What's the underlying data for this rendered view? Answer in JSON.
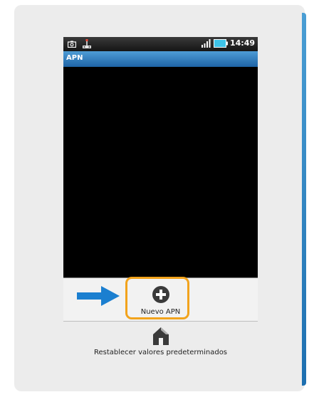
{
  "statusbar": {
    "time": "14:49",
    "icons": [
      "camera-icon",
      "usb-icon",
      "signal-icon",
      "battery-icon"
    ]
  },
  "titlebar": {
    "title": "APN"
  },
  "menu": {
    "items": [
      {
        "label": "Nuevo APN",
        "icon": "plus-circle-icon"
      },
      {
        "label": "Restablecer valores predeterminados",
        "icon": "home-icon"
      }
    ]
  },
  "colors": {
    "accent_blue": "#1e64a6",
    "highlight_orange": "#f2a31c",
    "arrow_blue": "#1b7fd0"
  }
}
